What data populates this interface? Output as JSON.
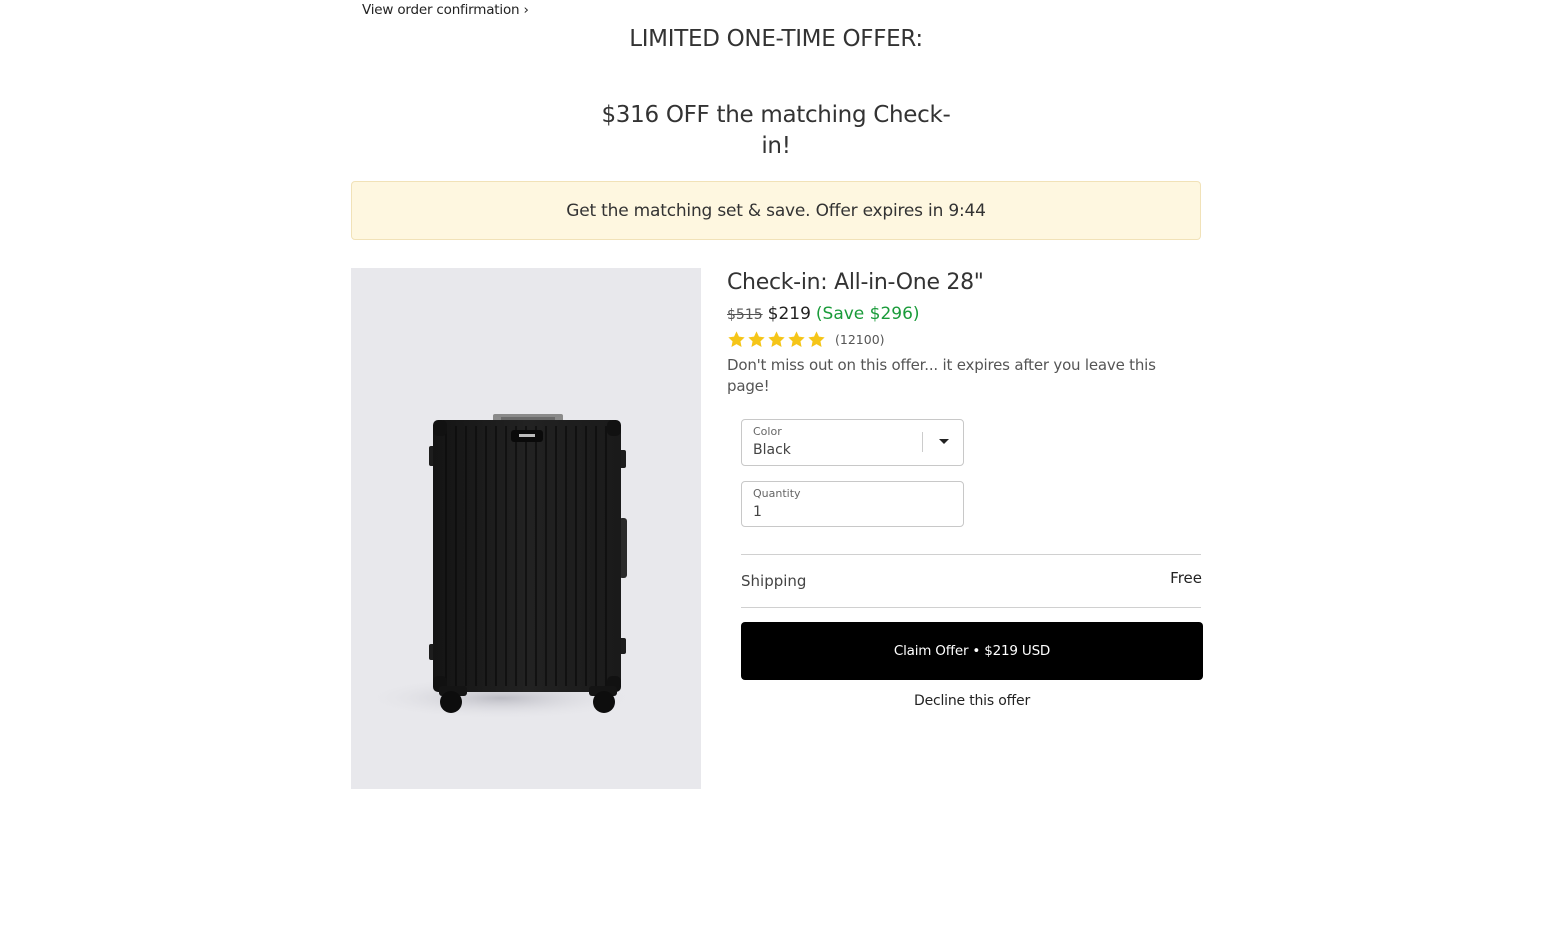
{
  "header": {
    "view_order_link": "View order confirmation ›",
    "headline": "LIMITED ONE-TIME OFFER:",
    "subheadline": "$316 OFF the matching Check-in!"
  },
  "banner": {
    "text": "Get the matching set & save. Offer expires in 9:44"
  },
  "product": {
    "image_icon": "suitcase-image",
    "title": "Check-in: All-in-One 28\"",
    "original_price": "$515",
    "sale_price": "$219",
    "savings": "(Save $296)",
    "rating": 5,
    "review_count": "(12100)",
    "urgency_text": "Don't miss out on this offer... it expires after you leave this page!"
  },
  "options": {
    "color_label": "Color",
    "color_value": "Black",
    "quantity_label": "Quantity",
    "quantity_value": "1"
  },
  "summary": {
    "shipping_label": "Shipping",
    "shipping_value": "Free"
  },
  "actions": {
    "claim_label": "Claim Offer • $219 USD",
    "decline_label": "Decline this offer"
  },
  "colors": {
    "banner_bg": "#fef7e0",
    "savings_green": "#1a9b3a",
    "star_gold": "#f5c518",
    "button_black": "#000000"
  }
}
